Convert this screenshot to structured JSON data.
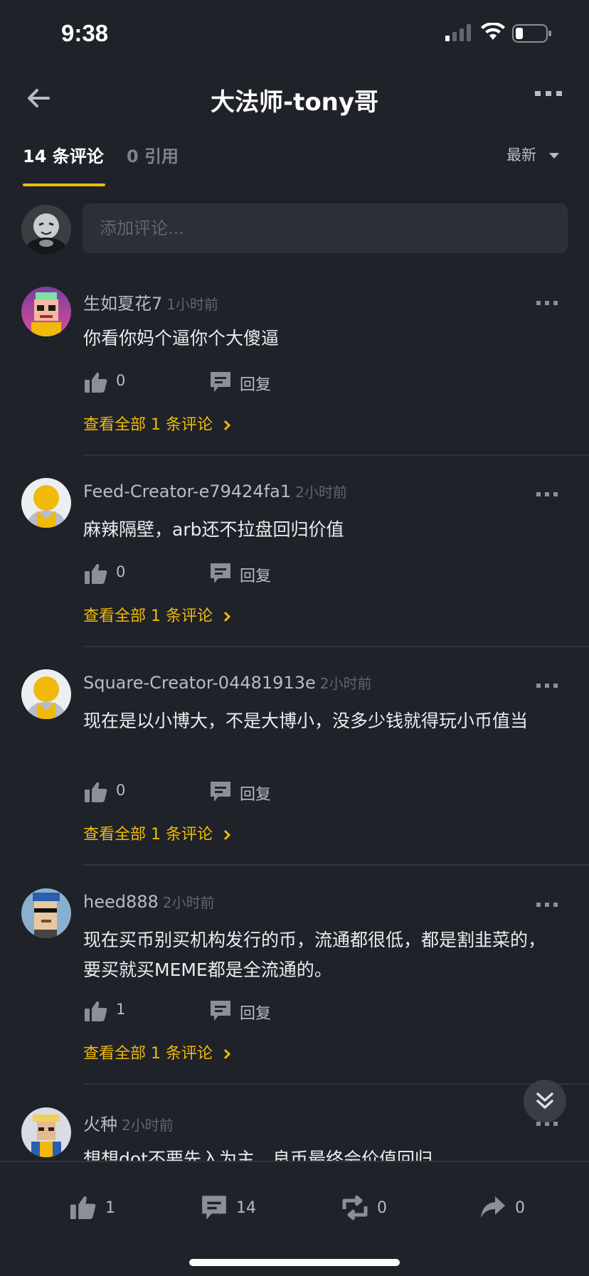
{
  "status": {
    "time": "9:38"
  },
  "nav": {
    "title": "大法师-tony哥"
  },
  "tabs": {
    "comments": "14 条评论",
    "quotes": "0 引用",
    "sort": "最新"
  },
  "input": {
    "placeholder": "添加评论..."
  },
  "comments": [
    {
      "user": "生如夏花7",
      "time": "1小时前",
      "text": "你看你妈个逼你个大傻逼",
      "likes": "0",
      "reply": "回复",
      "view_all": "查看全部 1 条评论"
    },
    {
      "user": "Feed-Creator-e79424fa1",
      "time": "2小时前",
      "text": "麻辣隔壁，arb还不拉盘回归价值",
      "likes": "0",
      "reply": "回复",
      "view_all": "查看全部 1 条评论"
    },
    {
      "user": "Square-Creator-04481913e",
      "time": "2小时前",
      "text": "现在是以小博大，不是大博小，没多少钱就得玩小币值当",
      "likes": "0",
      "reply": "回复",
      "view_all": "查看全部 1 条评论"
    },
    {
      "user": "heed888",
      "time": "2小时前",
      "text": "现在买币别买机构发行的币，流通都很低，都是割韭菜的，要买就买MEME都是全流通的。",
      "likes": "1",
      "reply": "回复",
      "view_all": "查看全部 1 条评论"
    },
    {
      "user": "火种",
      "time": "2小时前",
      "text": "想想dot不要先入为主，良币最终会价值回归"
    }
  ],
  "bottom": {
    "likes": "1",
    "comments": "14",
    "reposts": "0",
    "shares": "0"
  },
  "icons": [
    "back-arrow-icon",
    "more-icon",
    "caret-down-icon",
    "thumbs-up-icon",
    "reply-icon",
    "chevron-right-icon",
    "double-chevron-down-icon",
    "comment-icon",
    "repost-icon",
    "share-icon"
  ],
  "colors": {
    "accent": "#f0b90b",
    "background": "#1f2229",
    "input_bg": "#2b2f36"
  }
}
